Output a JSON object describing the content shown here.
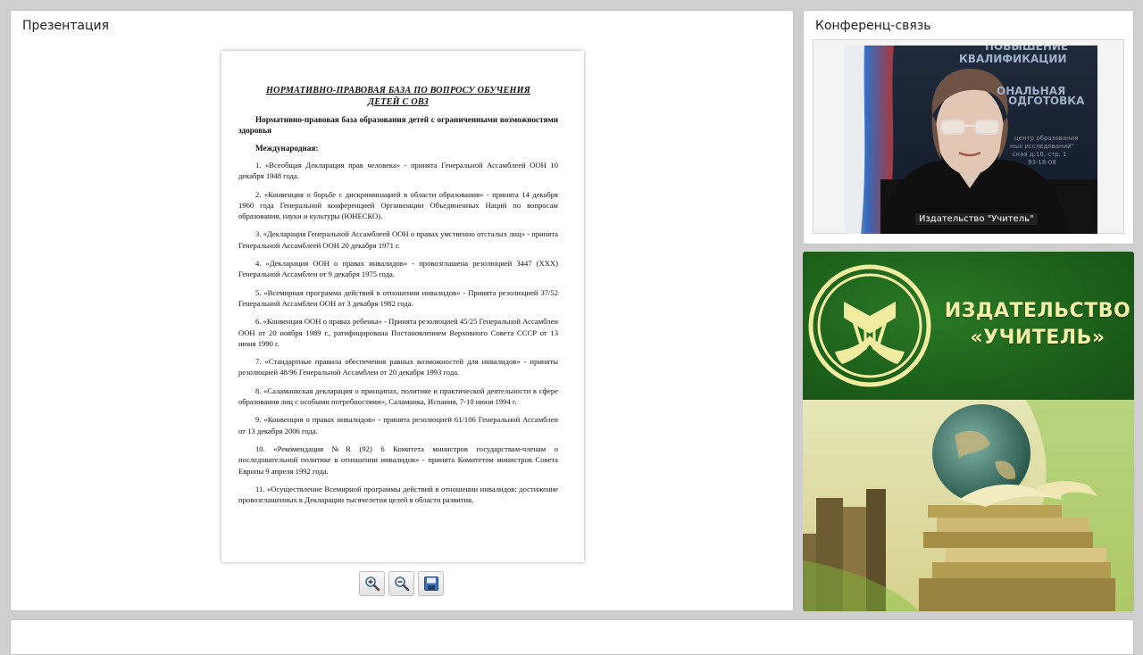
{
  "presentation": {
    "title": "Презентация",
    "document": {
      "title_line1": "НОРМАТИВНО-ПРАВОВАЯ БАЗА ПО ВОПРОСУ ОБУЧЕНИЯ",
      "title_line2": "ДЕТЕЙ С ОВЗ",
      "heading": "Нормативно-правовая база образования детей с ограниченными возможностями здоровья",
      "subheading": "Международная:",
      "items": [
        "1. «Всеобщая Декларация прав человека» - принята Генеральной Ассамблеей ООН 10 декабря 1948 года.",
        "2. «Конвенция о борьбе с дискриминацией в области образования» - принята 14 декабря 1960 года Генеральной конференцией Организации Объединенных Наций по вопросам образования, науки и культуры (ЮНЕСКО).",
        "3. «Декларация Генеральной Ассамблеей ООН о правах умственно отсталых лиц» - принята Генеральной Ассамблеей ООН 20 декабря 1971 г.",
        "4. «Декларация ООН о правах инвалидов» - провозглашена резолюцией 3447 (XXX) Генеральной Ассамблеи от 9 декабря 1975 года.",
        "5. «Всемирная программа действий в отношении инвалидов» - Принята резолюцией 37/52 Генеральной Ассамблеи ООН от 3 декабря 1982 года.",
        "6. «Конвенция ООН о правах ребенка» - Принята резолюцией 45/25 Генеральной Ассамблеи ООН от 20 ноября 1989 г., ратифицирована Постановлением Верховного Совета СССР от 13 июня 1990 г.",
        "7. «Стандартные правила обеспечения равных возможностей для инвалидов» - приняты резолюцией 48/96 Генеральной Ассамблеи от 20 декабря 1993 года.",
        "8. «Саламанкская декларация о принципах, политике и практической деятельности в сфере образования лиц с особыми потребностями», Саламанка, Испания, 7-10 июня 1994 г.",
        "9. «Конвенция о правах инвалидов» - принята резолюцией 61/106 Генеральной Ассамблеи от 13 декабря 2006 года.",
        "10. «Рекомендация №R (92) 6 Комитета министров государствам-членам о последовательной политике в отношении инвалидов» - принята Комитетом министров Совета Европы 9 апреля 1992 года.",
        "11. «Осуществление Всемирной программы действий в отношении инвалидов: достижение провозглашенных в Декларации тысячелетия целей в области развития,"
      ]
    },
    "toolbar": {
      "zoom_in_icon": "zoom-in-icon",
      "zoom_out_icon": "zoom-out-icon",
      "save_icon": "save-icon"
    }
  },
  "conference": {
    "title": "Конференц-связь",
    "participant_name": "Издательство \"Учитель\"",
    "background_banner": {
      "line1": "ПОВЫШЕНИЕ",
      "line2": "КВАЛИФИКАЦИИ",
      "line3": "ОНАЛЬНАЯ",
      "line4": "ОДГОТОВКА",
      "line5": "центр образования",
      "line6": "ных исследований\"",
      "line7": "ская д.16, стр. 1",
      "line8": "93-18-08"
    }
  },
  "brand": {
    "line1": "ИЗДАТЕЛЬСТВО",
    "line2": "«УЧИТЕЛЬ»",
    "colors": {
      "green": "#1e5a1b",
      "text": "#f3f0a8"
    }
  }
}
